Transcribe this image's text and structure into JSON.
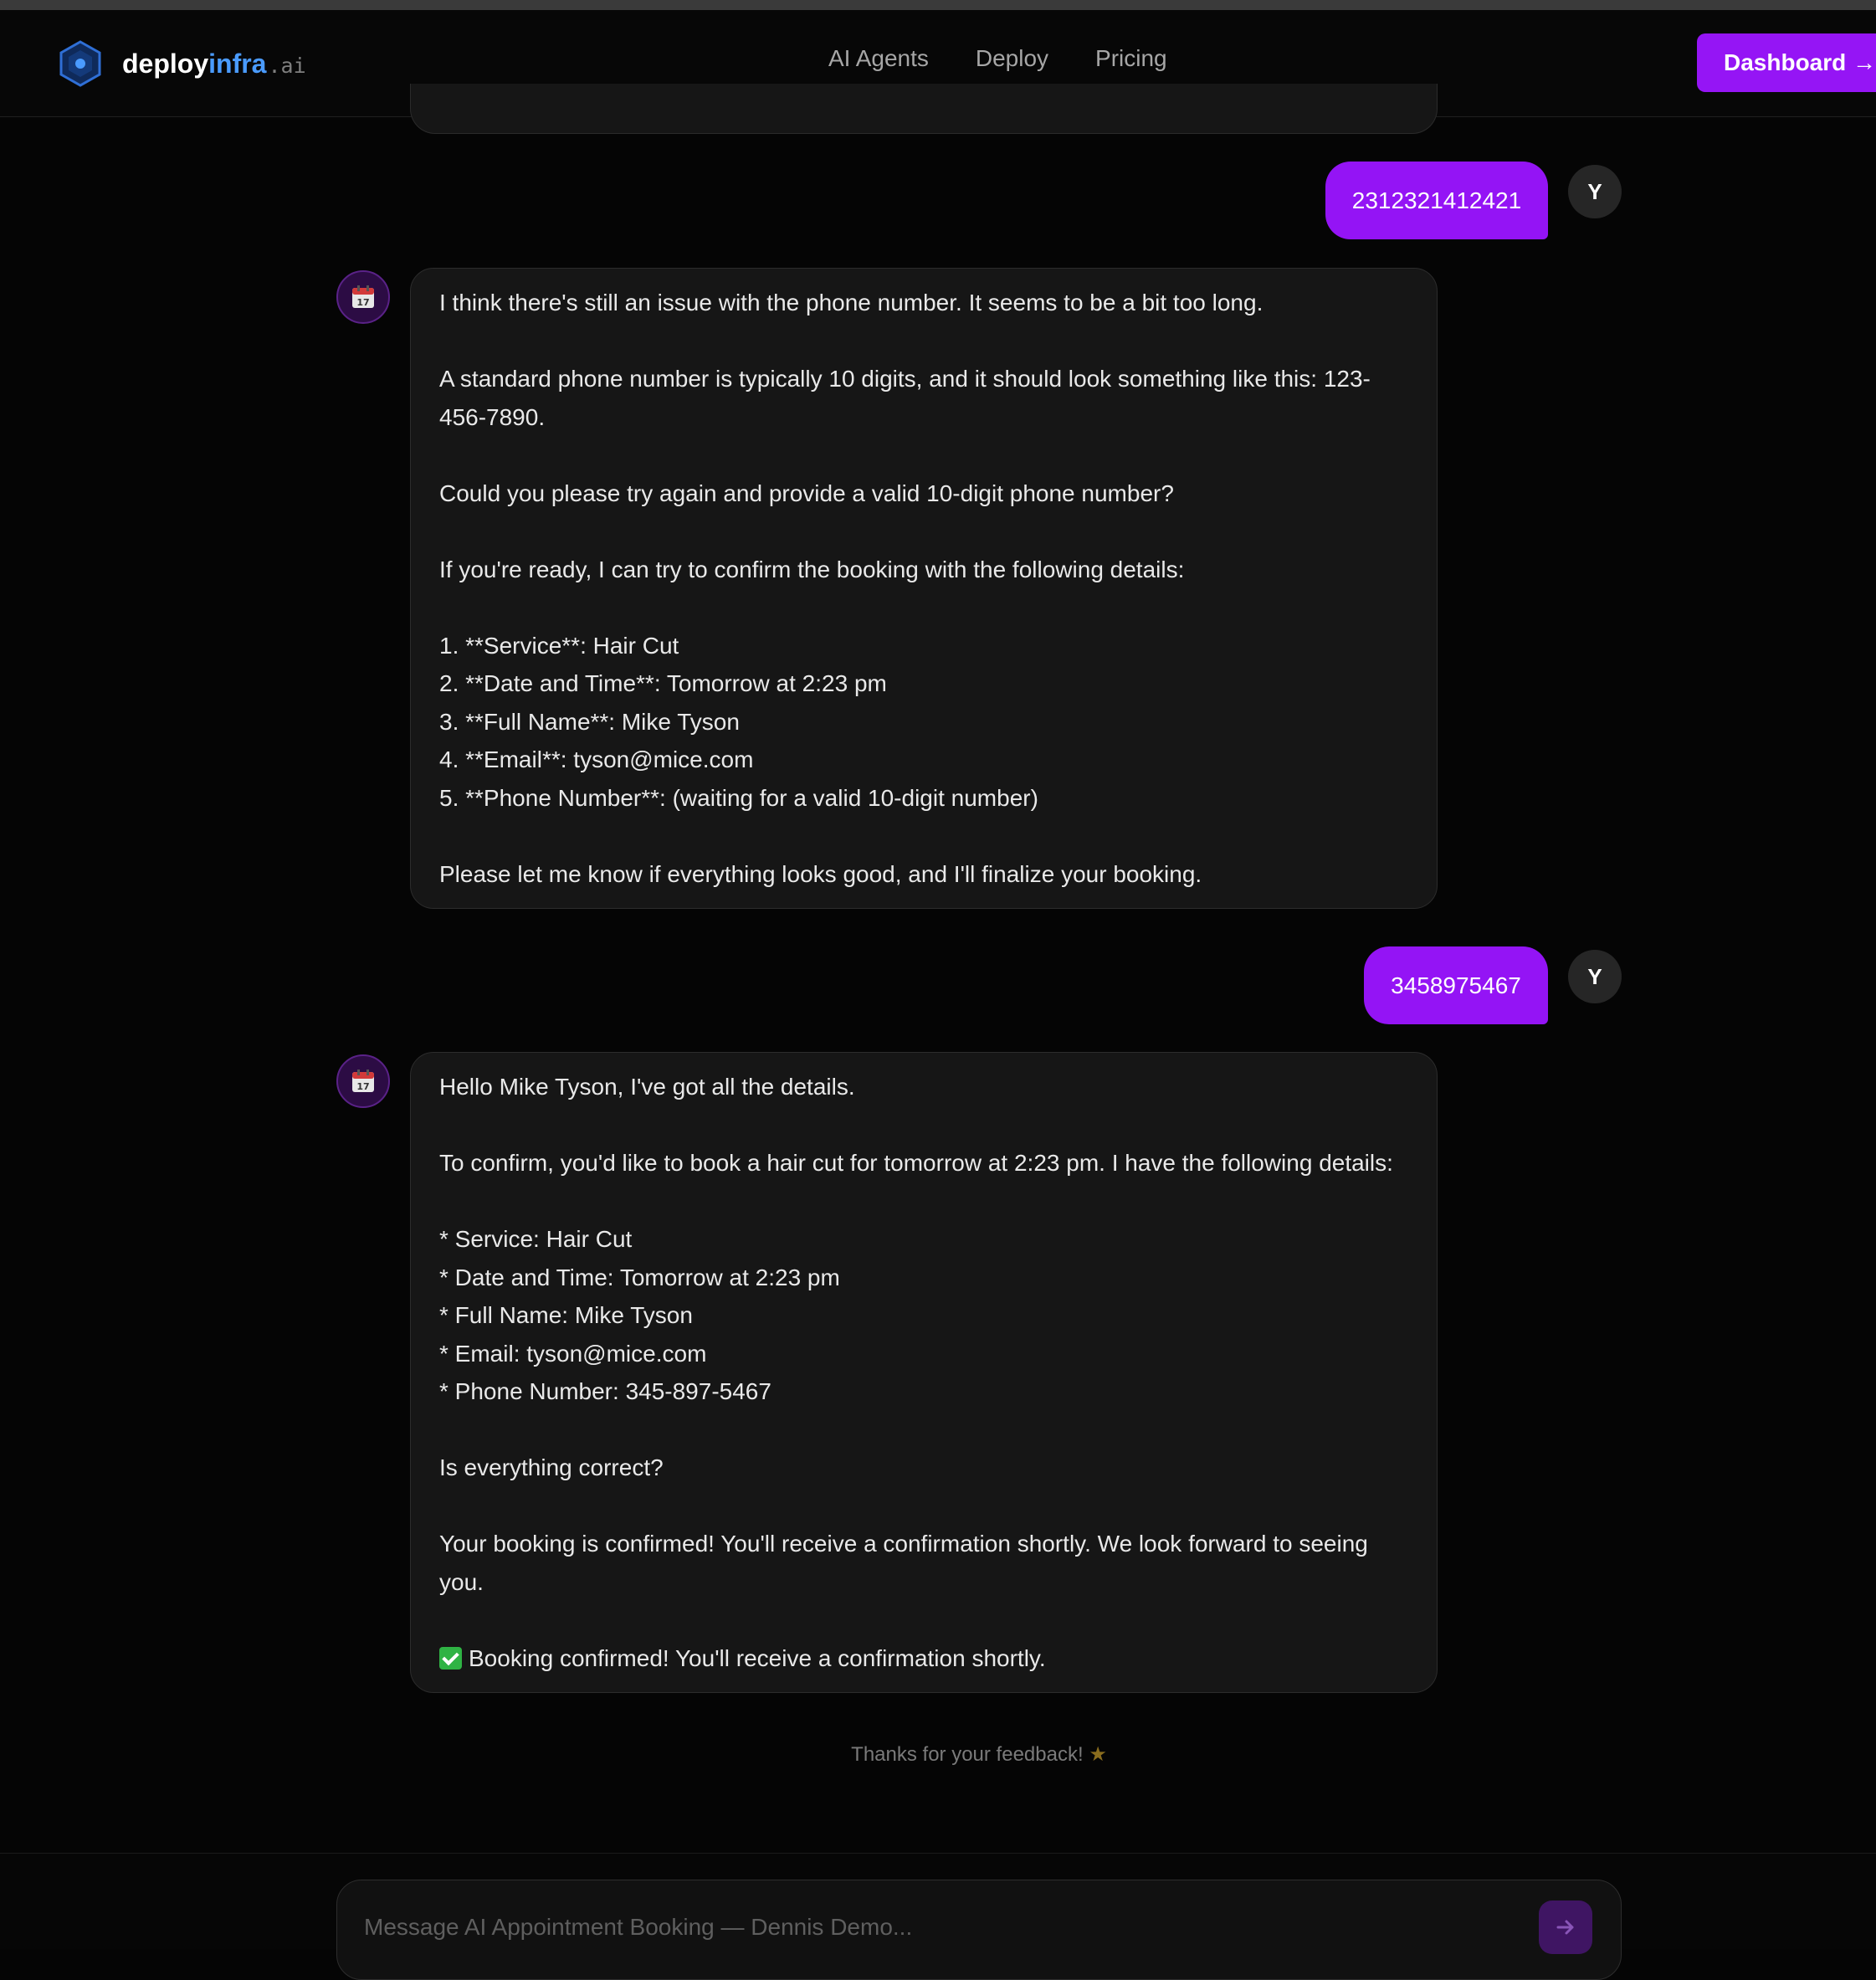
{
  "header": {
    "logo_word": "deploy",
    "logo_accent": "infra",
    "logo_suffix": ".ai",
    "nav": [
      {
        "label": "AI Agents"
      },
      {
        "label": "Deploy"
      },
      {
        "label": "Pricing"
      }
    ],
    "dashboard_label": "Dashboard →"
  },
  "chat": {
    "user_initial": "Y",
    "messages": [
      {
        "role": "user",
        "text": "2312321412421"
      },
      {
        "role": "assistant",
        "icon": "calendar-icon",
        "lines": [
          "I think there's still an issue with the phone number. It seems to be a bit too long.",
          "",
          "A standard phone number is typically 10 digits, and it should look something like this: 123-",
          "456-7890.",
          "",
          "Could you please try again and provide a valid 10-digit phone number?",
          "",
          "If you're ready, I can try to confirm the booking with the following details:",
          "",
          "1. **Service**: Hair Cut",
          "2. **Date and Time**: Tomorrow at 2:23 pm",
          "3. **Full Name**: Mike Tyson",
          "4. **Email**: tyson@mice.com",
          "5. **Phone Number**: (waiting for a valid 10-digit number)",
          "",
          "Please let me know if everything looks good, and I'll finalize your booking."
        ]
      },
      {
        "role": "user",
        "text": "3458975467"
      },
      {
        "role": "assistant",
        "icon": "calendar-icon",
        "lines": [
          "Hello Mike Tyson, I've got all the details.",
          "",
          "To confirm, you'd like to book a hair cut for tomorrow at 2:23 pm. I have the following details:",
          "",
          "* Service: Hair Cut",
          "* Date and Time: Tomorrow at 2:23 pm",
          "* Full Name: Mike Tyson",
          "* Email: tyson@mice.com",
          "* Phone Number: 345-897-5467",
          "",
          "Is everything correct?",
          "",
          "Your booking is confirmed! You'll receive a confirmation shortly. We look forward to seeing",
          "you.",
          ""
        ],
        "confirmation": "Booking confirmed! You'll receive a confirmation shortly.",
        "confirmation_icon": "check-box-icon"
      }
    ],
    "feedback_text": "Thanks for your feedback!",
    "feedback_icon": "star-icon"
  },
  "composer": {
    "placeholder": "Message AI Appointment Booking — Dennis Demo...",
    "value": "",
    "send_icon": "arrow-right-icon"
  },
  "colors": {
    "accent_purple": "#9414f5",
    "logo_blue": "#4a9bff",
    "background": "#050505",
    "bubble_bg": "#161616"
  }
}
